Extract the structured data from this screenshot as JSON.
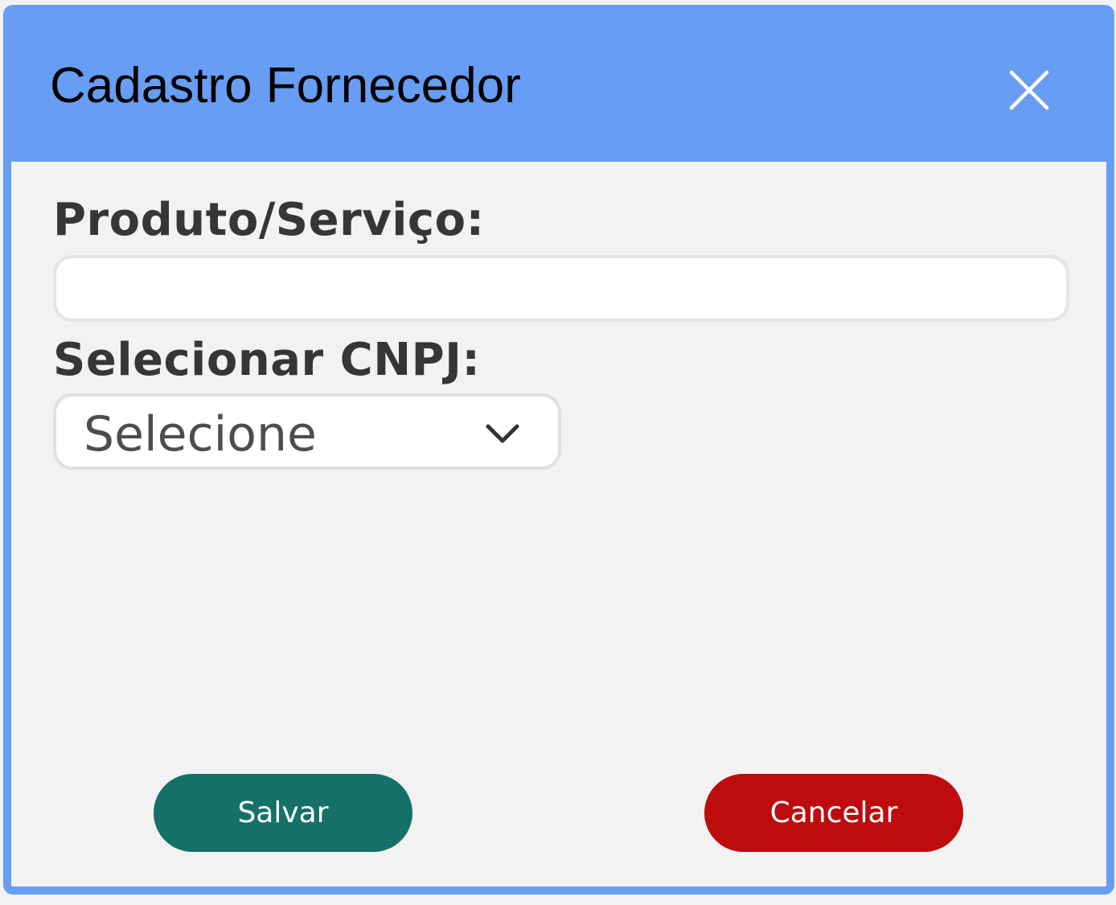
{
  "dialog": {
    "title": "Cadastro Fornecedor"
  },
  "icons": {
    "close": "close-icon",
    "select_arrow": "chevron-down-icon"
  },
  "form": {
    "produto_label": "Produto/Serviço:",
    "produto_value": "",
    "cnpj_label": "Selecionar CNPJ:",
    "cnpj_selected": "Selecione"
  },
  "actions": {
    "save_label": "Salvar",
    "cancel_label": "Cancelar"
  },
  "colors": {
    "header": "#679df2",
    "background": "#f2f2f2",
    "save": "#157167",
    "cancel": "#bc0c0e",
    "label_text": "#363636"
  }
}
